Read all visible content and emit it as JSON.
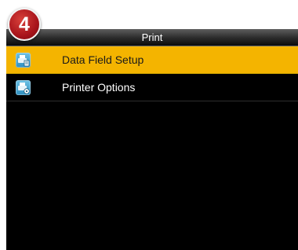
{
  "step_badge": {
    "number": "4",
    "color": "#b01a1f"
  },
  "title": "Print",
  "menu": {
    "items": [
      {
        "label": "Data Field Setup",
        "icon": "printer-data-field-icon",
        "selected": true
      },
      {
        "label": "Printer Options",
        "icon": "printer-options-icon",
        "selected": false
      }
    ]
  },
  "colors": {
    "selected_background": "#f4b400",
    "screen_background": "#000000",
    "step_badge": "#b01a1f"
  }
}
